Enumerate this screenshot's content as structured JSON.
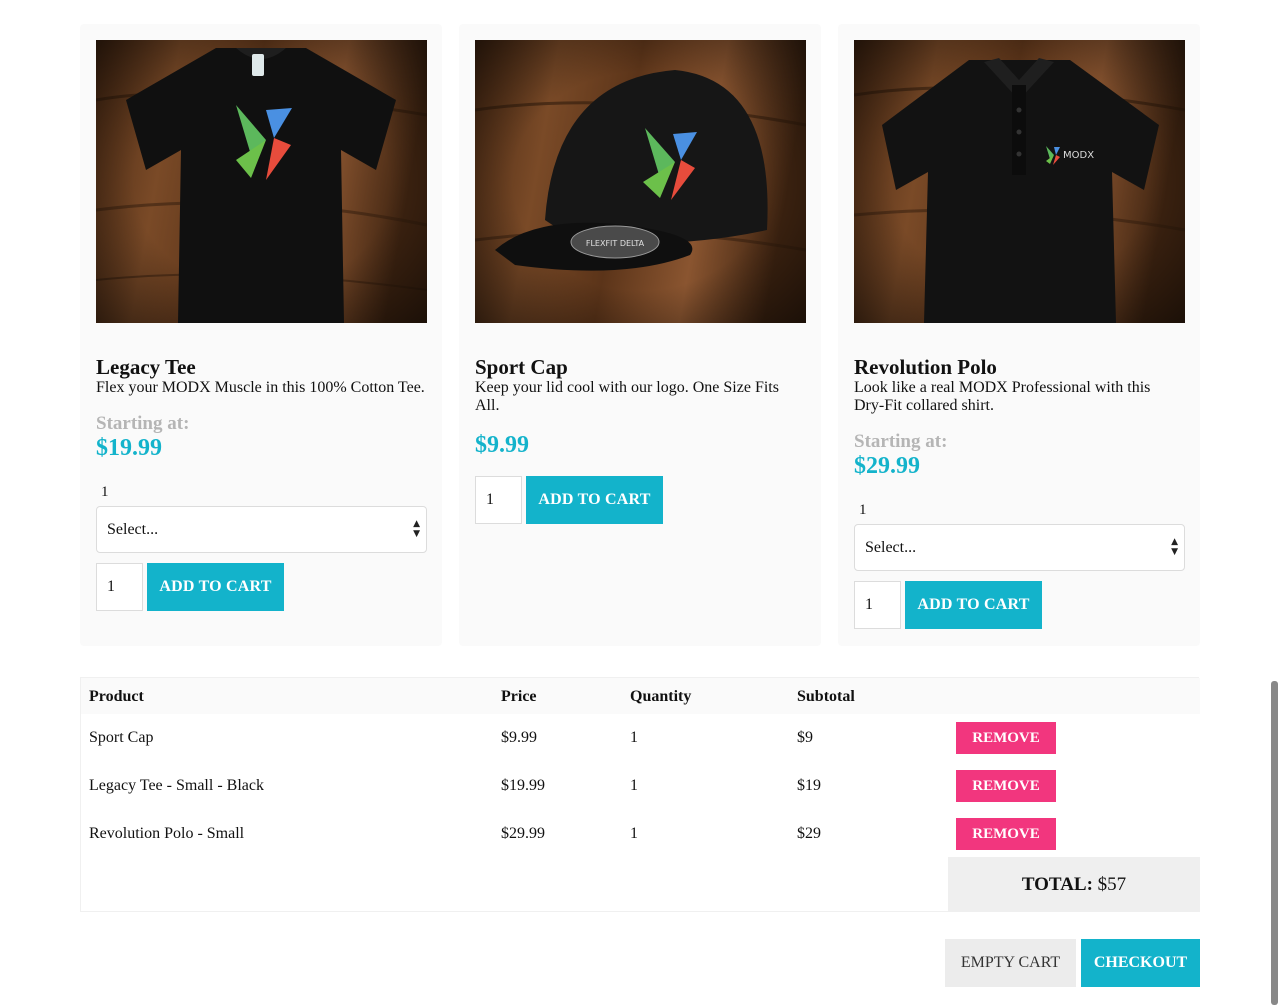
{
  "products": [
    {
      "title": "Legacy Tee",
      "description": "Flex your MODX Muscle in this 100% Cotton Tee.",
      "starting_label": "Starting at:",
      "price": "$19.99",
      "qty_label": "1",
      "select_value": "Select...",
      "qty_value": "1",
      "add_label": "ADD TO CART",
      "image": "black-tshirt-modx-logo"
    },
    {
      "title": "Sport Cap",
      "description": "Keep your lid cool with our logo. One Size Fits All.",
      "price": "$9.99",
      "qty_value": "1",
      "add_label": "ADD TO CART",
      "image": "black-cap-modx-logo",
      "cap_badge": "FLEXFIT DELTA"
    },
    {
      "title": "Revolution Polo",
      "description": "Look like a real MODX Professional with this Dry-Fit collared shirt.",
      "starting_label": "Starting at:",
      "price": "$29.99",
      "qty_label": "1",
      "select_value": "Select...",
      "qty_value": "1",
      "add_label": "ADD TO CART",
      "image": "black-polo-modx-logo",
      "polo_logo_text": "MODX"
    }
  ],
  "cart": {
    "headers": {
      "product": "Product",
      "price": "Price",
      "quantity": "Quantity",
      "subtotal": "Subtotal"
    },
    "rows": [
      {
        "product": "Sport Cap",
        "price": "$9.99",
        "quantity": "1",
        "subtotal": "$9",
        "remove": "REMOVE"
      },
      {
        "product": "Legacy Tee - Small - Black",
        "price": "$19.99",
        "quantity": "1",
        "subtotal": "$19",
        "remove": "REMOVE"
      },
      {
        "product": "Revolution Polo - Small",
        "price": "$29.99",
        "quantity": "1",
        "subtotal": "$29",
        "remove": "REMOVE"
      }
    ],
    "total_label": "TOTAL:",
    "total_value": "$57"
  },
  "actions": {
    "empty_cart": "EMPTY CART",
    "checkout": "CHECKOUT"
  },
  "colors": {
    "accent": "#13b3cb",
    "remove": "#f2367e",
    "muted": "#b5b5b5"
  }
}
